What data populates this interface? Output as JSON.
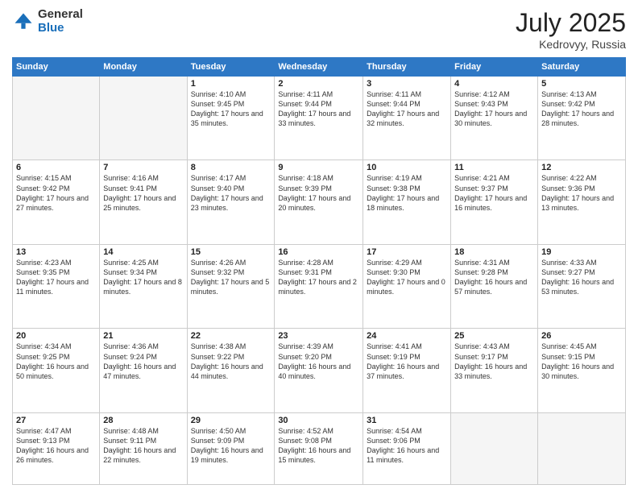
{
  "logo": {
    "general": "General",
    "blue": "Blue"
  },
  "title": "July 2025",
  "location": "Kedrovyy, Russia",
  "days_of_week": [
    "Sunday",
    "Monday",
    "Tuesday",
    "Wednesday",
    "Thursday",
    "Friday",
    "Saturday"
  ],
  "weeks": [
    [
      {
        "day": "",
        "info": ""
      },
      {
        "day": "",
        "info": ""
      },
      {
        "day": "1",
        "info": "Sunrise: 4:10 AM\nSunset: 9:45 PM\nDaylight: 17 hours and 35 minutes."
      },
      {
        "day": "2",
        "info": "Sunrise: 4:11 AM\nSunset: 9:44 PM\nDaylight: 17 hours and 33 minutes."
      },
      {
        "day": "3",
        "info": "Sunrise: 4:11 AM\nSunset: 9:44 PM\nDaylight: 17 hours and 32 minutes."
      },
      {
        "day": "4",
        "info": "Sunrise: 4:12 AM\nSunset: 9:43 PM\nDaylight: 17 hours and 30 minutes."
      },
      {
        "day": "5",
        "info": "Sunrise: 4:13 AM\nSunset: 9:42 PM\nDaylight: 17 hours and 28 minutes."
      }
    ],
    [
      {
        "day": "6",
        "info": "Sunrise: 4:15 AM\nSunset: 9:42 PM\nDaylight: 17 hours and 27 minutes."
      },
      {
        "day": "7",
        "info": "Sunrise: 4:16 AM\nSunset: 9:41 PM\nDaylight: 17 hours and 25 minutes."
      },
      {
        "day": "8",
        "info": "Sunrise: 4:17 AM\nSunset: 9:40 PM\nDaylight: 17 hours and 23 minutes."
      },
      {
        "day": "9",
        "info": "Sunrise: 4:18 AM\nSunset: 9:39 PM\nDaylight: 17 hours and 20 minutes."
      },
      {
        "day": "10",
        "info": "Sunrise: 4:19 AM\nSunset: 9:38 PM\nDaylight: 17 hours and 18 minutes."
      },
      {
        "day": "11",
        "info": "Sunrise: 4:21 AM\nSunset: 9:37 PM\nDaylight: 17 hours and 16 minutes."
      },
      {
        "day": "12",
        "info": "Sunrise: 4:22 AM\nSunset: 9:36 PM\nDaylight: 17 hours and 13 minutes."
      }
    ],
    [
      {
        "day": "13",
        "info": "Sunrise: 4:23 AM\nSunset: 9:35 PM\nDaylight: 17 hours and 11 minutes."
      },
      {
        "day": "14",
        "info": "Sunrise: 4:25 AM\nSunset: 9:34 PM\nDaylight: 17 hours and 8 minutes."
      },
      {
        "day": "15",
        "info": "Sunrise: 4:26 AM\nSunset: 9:32 PM\nDaylight: 17 hours and 5 minutes."
      },
      {
        "day": "16",
        "info": "Sunrise: 4:28 AM\nSunset: 9:31 PM\nDaylight: 17 hours and 2 minutes."
      },
      {
        "day": "17",
        "info": "Sunrise: 4:29 AM\nSunset: 9:30 PM\nDaylight: 17 hours and 0 minutes."
      },
      {
        "day": "18",
        "info": "Sunrise: 4:31 AM\nSunset: 9:28 PM\nDaylight: 16 hours and 57 minutes."
      },
      {
        "day": "19",
        "info": "Sunrise: 4:33 AM\nSunset: 9:27 PM\nDaylight: 16 hours and 53 minutes."
      }
    ],
    [
      {
        "day": "20",
        "info": "Sunrise: 4:34 AM\nSunset: 9:25 PM\nDaylight: 16 hours and 50 minutes."
      },
      {
        "day": "21",
        "info": "Sunrise: 4:36 AM\nSunset: 9:24 PM\nDaylight: 16 hours and 47 minutes."
      },
      {
        "day": "22",
        "info": "Sunrise: 4:38 AM\nSunset: 9:22 PM\nDaylight: 16 hours and 44 minutes."
      },
      {
        "day": "23",
        "info": "Sunrise: 4:39 AM\nSunset: 9:20 PM\nDaylight: 16 hours and 40 minutes."
      },
      {
        "day": "24",
        "info": "Sunrise: 4:41 AM\nSunset: 9:19 PM\nDaylight: 16 hours and 37 minutes."
      },
      {
        "day": "25",
        "info": "Sunrise: 4:43 AM\nSunset: 9:17 PM\nDaylight: 16 hours and 33 minutes."
      },
      {
        "day": "26",
        "info": "Sunrise: 4:45 AM\nSunset: 9:15 PM\nDaylight: 16 hours and 30 minutes."
      }
    ],
    [
      {
        "day": "27",
        "info": "Sunrise: 4:47 AM\nSunset: 9:13 PM\nDaylight: 16 hours and 26 minutes."
      },
      {
        "day": "28",
        "info": "Sunrise: 4:48 AM\nSunset: 9:11 PM\nDaylight: 16 hours and 22 minutes."
      },
      {
        "day": "29",
        "info": "Sunrise: 4:50 AM\nSunset: 9:09 PM\nDaylight: 16 hours and 19 minutes."
      },
      {
        "day": "30",
        "info": "Sunrise: 4:52 AM\nSunset: 9:08 PM\nDaylight: 16 hours and 15 minutes."
      },
      {
        "day": "31",
        "info": "Sunrise: 4:54 AM\nSunset: 9:06 PM\nDaylight: 16 hours and 11 minutes."
      },
      {
        "day": "",
        "info": ""
      },
      {
        "day": "",
        "info": ""
      }
    ]
  ]
}
